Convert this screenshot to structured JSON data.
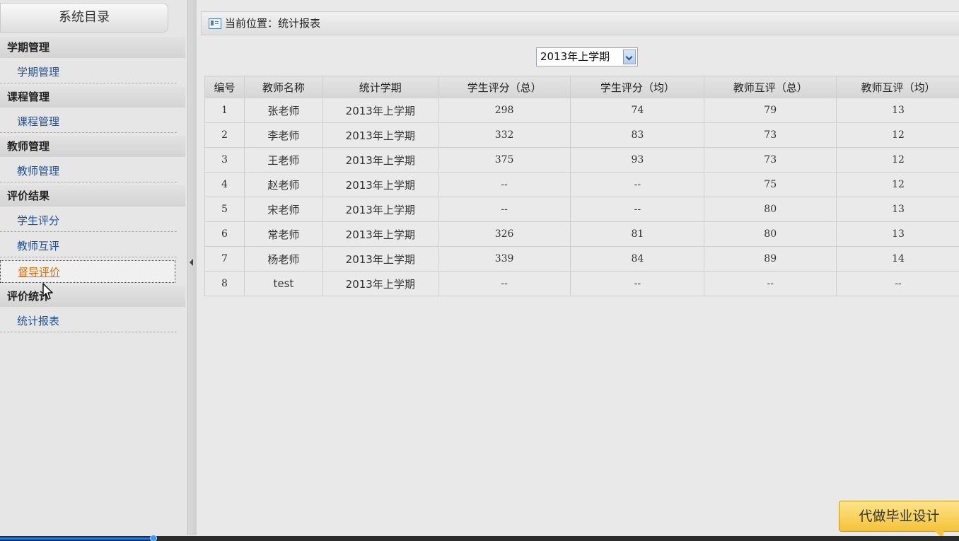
{
  "sidebar": {
    "header": "系统目录",
    "sections": [
      {
        "title": "学期管理",
        "items": [
          {
            "label": "学期管理"
          }
        ]
      },
      {
        "title": "课程管理",
        "items": [
          {
            "label": "课程管理"
          }
        ]
      },
      {
        "title": "教师管理",
        "items": [
          {
            "label": "教师管理"
          }
        ]
      },
      {
        "title": "评价结果",
        "items": [
          {
            "label": "学生评分"
          },
          {
            "label": "教师互评"
          },
          {
            "label": "督导评价",
            "active": true
          }
        ]
      },
      {
        "title": "评价统计",
        "items": [
          {
            "label": "统计报表"
          }
        ]
      }
    ]
  },
  "location": {
    "text": "当前位置：统计报表"
  },
  "semester_select": {
    "value": "2013年上学期"
  },
  "table": {
    "columns": [
      "编号",
      "教师名称",
      "统计学期",
      "学生评分（总）",
      "学生评分（均）",
      "教师互评（总）",
      "教师互评（均）"
    ],
    "rows": [
      [
        "1",
        "张老师",
        "2013年上学期",
        "298",
        "74",
        "79",
        "13"
      ],
      [
        "2",
        "李老师",
        "2013年上学期",
        "332",
        "83",
        "73",
        "12"
      ],
      [
        "3",
        "王老师",
        "2013年上学期",
        "375",
        "93",
        "73",
        "12"
      ],
      [
        "4",
        "赵老师",
        "2013年上学期",
        "--",
        "--",
        "75",
        "12"
      ],
      [
        "5",
        "宋老师",
        "2013年上学期",
        "--",
        "--",
        "80",
        "13"
      ],
      [
        "6",
        "常老师",
        "2013年上学期",
        "326",
        "81",
        "80",
        "13"
      ],
      [
        "7",
        "杨老师",
        "2013年上学期",
        "339",
        "84",
        "89",
        "14"
      ],
      [
        "8",
        "test",
        "2013年上学期",
        "--",
        "--",
        "--",
        "--"
      ]
    ]
  },
  "promo": {
    "label": "代做毕业设计"
  },
  "progress": {
    "fraction": 0.16
  },
  "colors": {
    "link": "#1d4f9a",
    "active_link": "#e0700a",
    "promo": "#f5c238"
  }
}
